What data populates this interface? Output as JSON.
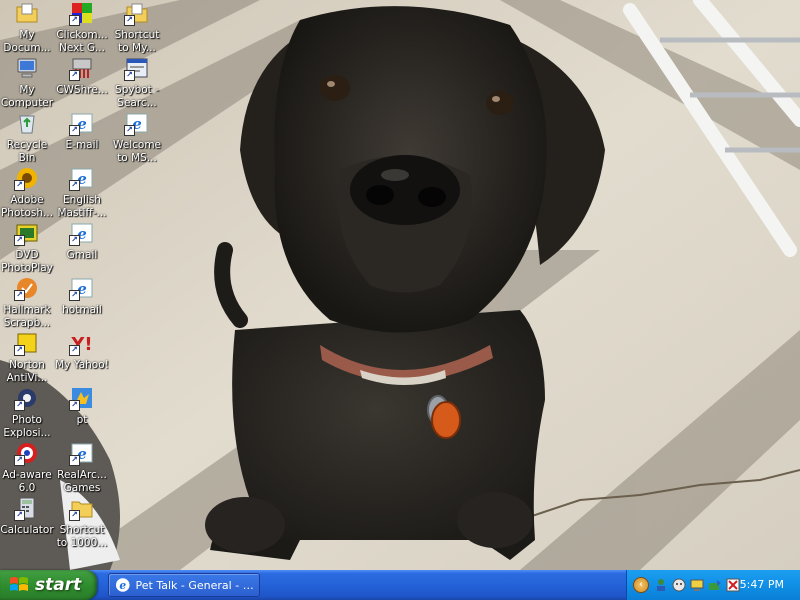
{
  "desktop": {
    "icons": [
      {
        "label": "My\nDocum...",
        "icon": "folder-documents-icon",
        "shortcut": false
      },
      {
        "label": "My\nComputer",
        "icon": "computer-icon",
        "shortcut": false
      },
      {
        "label": "Recycle\nBin",
        "icon": "recycle-bin-icon",
        "shortcut": false
      },
      {
        "label": "Adobe\nPhotosh...",
        "icon": "photoshop-icon",
        "shortcut": true
      },
      {
        "label": "DVD\nPhotoPlay",
        "icon": "dvd-icon",
        "shortcut": true
      },
      {
        "label": "Hallmark\nScrapb...",
        "icon": "hallmark-icon",
        "shortcut": true
      },
      {
        "label": "Norton\nAntiVi...",
        "icon": "norton-icon",
        "shortcut": true
      },
      {
        "label": "Photo\nExplosi...",
        "icon": "photo-explosion-icon",
        "shortcut": true
      },
      {
        "label": "Ad-aware\n6.0",
        "icon": "adaware-icon",
        "shortcut": true
      },
      {
        "label": "Calculator",
        "icon": "calculator-icon",
        "shortcut": true
      },
      {
        "label": "Clickom...\nNext G...",
        "icon": "clickomania-icon",
        "shortcut": true
      },
      {
        "label": "CWShre...",
        "icon": "cwshredder-icon",
        "shortcut": true
      },
      {
        "label": "E-mail",
        "icon": "ie-icon",
        "shortcut": true
      },
      {
        "label": "English\nMastiff-...",
        "icon": "ie-icon",
        "shortcut": true
      },
      {
        "label": "Gmail",
        "icon": "ie-icon",
        "shortcut": true
      },
      {
        "label": "hotmail",
        "icon": "ie-icon",
        "shortcut": true
      },
      {
        "label": "My Yahoo!",
        "icon": "yahoo-icon",
        "shortcut": true
      },
      {
        "label": "pt",
        "icon": "pt-icon",
        "shortcut": true
      },
      {
        "label": "RealArc...\nGames",
        "icon": "ie-icon",
        "shortcut": true
      },
      {
        "label": "Shortcut\nto 1000...",
        "icon": "folder-icon",
        "shortcut": true
      },
      {
        "label": "Shortcut\nto My...",
        "icon": "folder-documents-icon",
        "shortcut": true
      },
      {
        "label": "Spybot -\nSearc...",
        "icon": "spybot-icon",
        "shortcut": true
      },
      {
        "label": "Welcome\nto MS...",
        "icon": "ie-icon",
        "shortcut": true
      }
    ]
  },
  "taskbar": {
    "start_label": "start",
    "task_button_label": "Pet Talk - General - M...",
    "clock": "5:47 PM",
    "tray_icons": [
      "network-icon",
      "messenger-icon",
      "display-icon",
      "safely-remove-icon",
      "antivirus-icon"
    ]
  },
  "colors": {
    "taskbar_blue": "#2462d8",
    "start_green": "#2e8b2e",
    "tray_blue": "#1090e6"
  }
}
